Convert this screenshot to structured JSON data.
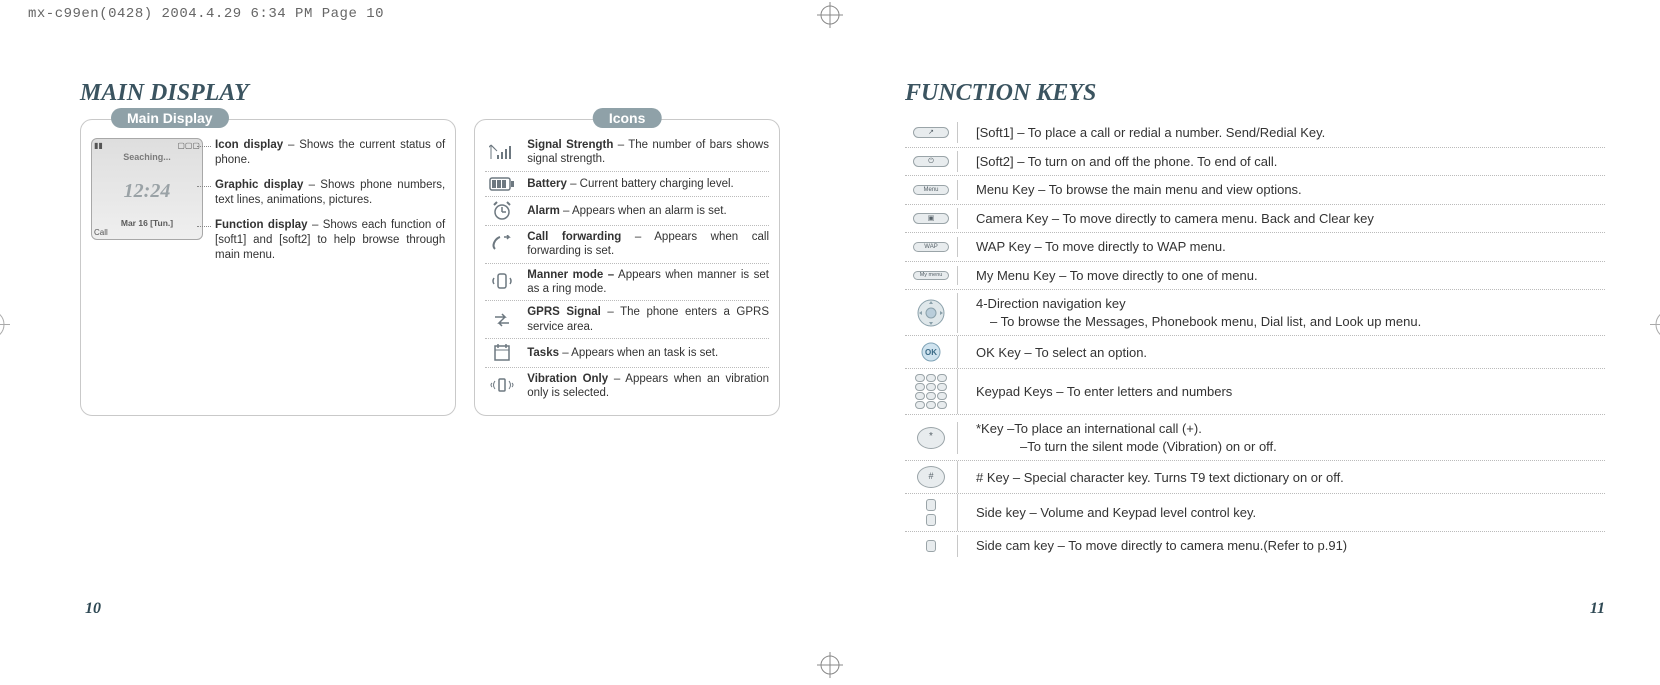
{
  "header_line": "mx-c99en(0428)  2004.4.29  6:34 PM  Page 10",
  "left": {
    "title": "MAIN DISPLAY",
    "main_display_label": "Main Display",
    "screen": {
      "top_left": "▮▮",
      "top_right": "▢▢▢",
      "seaching": "Seaching...",
      "date_line": "Mar  16 [Tun.]",
      "call": "Call"
    },
    "blocks": [
      {
        "bold": "Icon display",
        "rest": " – Shows the current status of phone."
      },
      {
        "bold": "Graphic display",
        "rest": " – Shows phone numbers, text lines, animations, pictures."
      },
      {
        "bold": "Function display",
        "rest": " – Shows each function of [soft1] and [soft2] to help browse through main menu."
      }
    ],
    "icons_label": "Icons",
    "icons": [
      {
        "bold": "Signal Strength",
        "rest": " – The number of bars shows signal strength."
      },
      {
        "bold": "Battery",
        "rest": " – Current battery charging level."
      },
      {
        "bold": "Alarm",
        "rest": " – Appears when an alarm is set."
      },
      {
        "bold": "Call forwarding",
        "rest": " – Appears when call forwarding is set."
      },
      {
        "bold": "Manner mode –",
        "rest": " Appears when manner is set as a ring mode."
      },
      {
        "bold": "GPRS Signal",
        "rest": " – The phone enters a GPRS service area."
      },
      {
        "bold": "Tasks",
        "rest": " – Appears when an task is set."
      },
      {
        "bold": "Vibration Only",
        "rest": " – Appears when an vibration only is selected."
      }
    ],
    "folio": "10"
  },
  "right": {
    "title": "FUNCTION KEYS",
    "rows": [
      {
        "key_label": "↗",
        "text": "[Soft1] – To place a call or redial a number. Send/Redial Key."
      },
      {
        "key_label": "⏻",
        "text": "[Soft2] – To turn on and off the phone. To end of call."
      },
      {
        "key_label": "Menu",
        "text": "Menu Key  – To browse the main menu and view options."
      },
      {
        "key_label": "📷",
        "text": "Camera Key – To move directly to camera menu. Back and Clear key"
      },
      {
        "key_label": "WAP",
        "text": "WAP Key – To move directly to WAP menu."
      },
      {
        "key_label": "My menu",
        "text": "My Menu Key – To move directly to one of menu."
      },
      {
        "key_label": "nav",
        "text": "4-Direction navigation key",
        "text2": "– To browse the Messages, Phonebook menu, Dial list, and Look up menu."
      },
      {
        "key_label": "OK",
        "text": "OK Key – To select an option."
      },
      {
        "key_label": "keypad",
        "text": "Keypad Keys – To enter letters and numbers"
      },
      {
        "key_label": "*",
        "text": "*Key –To place an international call (+).",
        "text2": "–To turn the silent mode (Vibration) on or off."
      },
      {
        "key_label": "#",
        "text": "# Key – Special character key. Turns T9 text dictionary on or off."
      },
      {
        "key_label": "side",
        "text": "Side key – Volume and Keypad level control key."
      },
      {
        "key_label": "sidecam",
        "text": "Side cam key – To move directly to camera menu.(Refer to p.91)"
      }
    ],
    "folio": "11"
  }
}
